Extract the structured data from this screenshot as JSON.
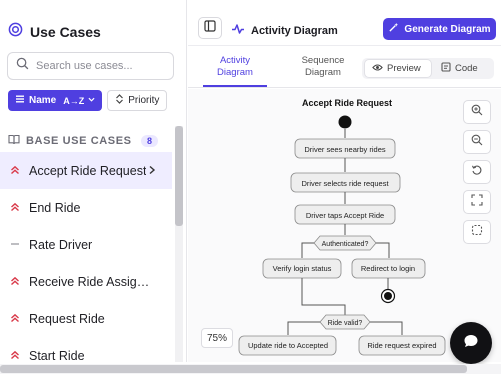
{
  "sidebar": {
    "title": "Use Cases",
    "search_placeholder": "Search use cases...",
    "sort_name": "Name",
    "sort_name_order": "A→Z",
    "sort_priority": "Priority",
    "section_label": "BASE USE CASES",
    "section_count": "8",
    "items": [
      {
        "label": "Accept Ride Request",
        "priority": "high",
        "selected": true
      },
      {
        "label": "End Ride",
        "priority": "high"
      },
      {
        "label": "Rate Driver",
        "priority": "low"
      },
      {
        "label": "Receive Ride Assign...",
        "priority": "high"
      },
      {
        "label": "Request Ride",
        "priority": "high"
      },
      {
        "label": "Start Ride",
        "priority": "high"
      }
    ]
  },
  "header": {
    "title": "Activity Diagram",
    "generate_label": "Generate Diagram"
  },
  "tabs": {
    "activity": "Activity\nDiagram",
    "sequence": "Sequence\nDiagram",
    "preview": "Preview",
    "code": "Code"
  },
  "diagram": {
    "title": "Accept Ride Request",
    "nodes": {
      "n1": "Driver sees nearby rides",
      "n2": "Driver selects ride request",
      "n3": "Driver taps Accept Ride",
      "d1": "Authenticated?",
      "n4": "Verify login status",
      "n5": "Redirect to login",
      "d2": "Ride valid?",
      "n6": "Update ride to Accepted",
      "n7": "Ride request expired"
    }
  },
  "zoom_level": "75%",
  "colors": {
    "accent": "#4f3fe0",
    "priority_high": "#d93a4a",
    "priority_low": "#9a9aa2"
  }
}
